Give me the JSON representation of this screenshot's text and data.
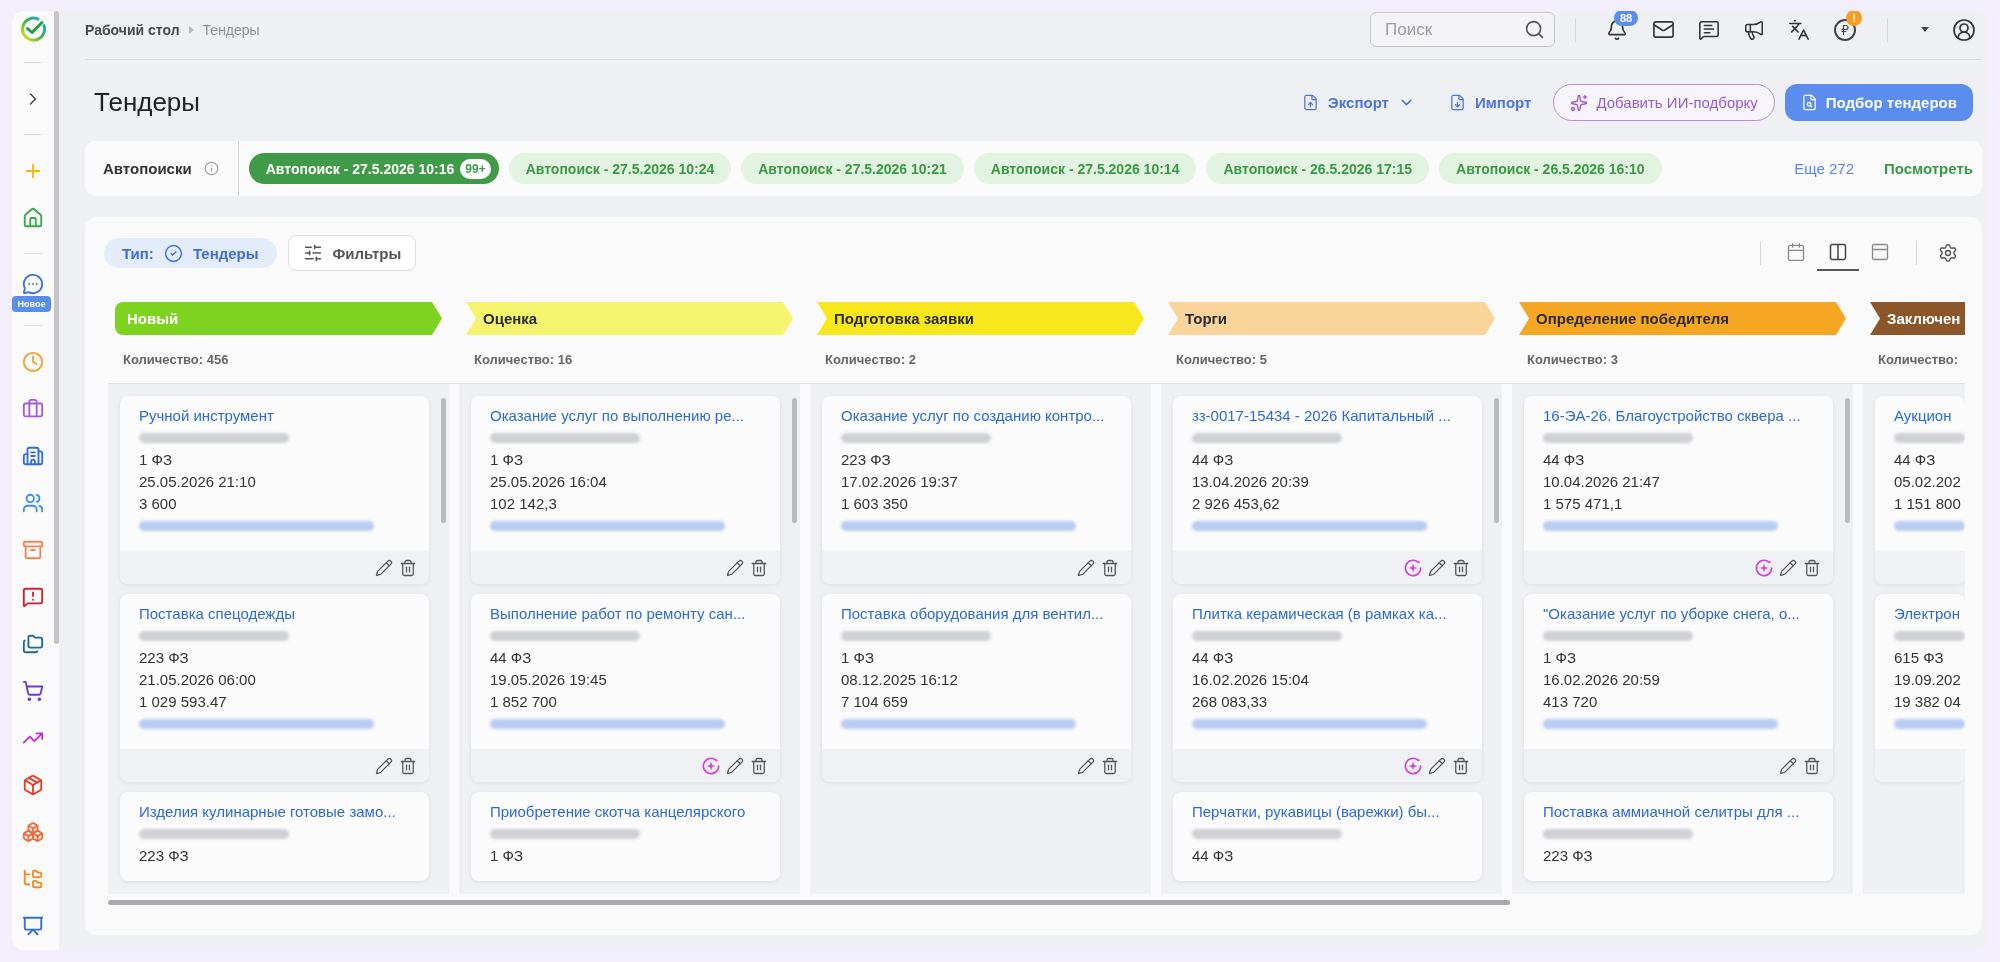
{
  "sidebar": {
    "new_badge": "Новое"
  },
  "topbar": {
    "breadcrumbs": [
      {
        "label": "Рабочий стол",
        "current": false
      },
      {
        "label": "Тендеры",
        "current": true
      }
    ],
    "search": {
      "placeholder": "Поиск"
    },
    "notifications_badge": "88",
    "coin_badge": "!"
  },
  "page": {
    "title": "Тендеры",
    "actions": [
      {
        "kind": "export",
        "label": "Экспорт"
      },
      {
        "kind": "import",
        "label": "Импорт"
      },
      {
        "kind": "ai",
        "label": "Добавить ИИ-подборку"
      },
      {
        "kind": "primary",
        "label": "Подбор тендеров"
      }
    ]
  },
  "autosearch": {
    "label": "Автопоиски",
    "chips": [
      {
        "label": "Автопоиск - 27.5.2026 10:16",
        "count": "99+",
        "selected": true
      },
      {
        "label": "Автопоиск - 27.5.2026 10:24",
        "selected": false
      },
      {
        "label": "Автопоиск - 27.5.2026 10:21",
        "selected": false
      },
      {
        "label": "Автопоиск - 27.5.2026 10:14",
        "selected": false
      },
      {
        "label": "Автопоиск - 26.5.2026 17:15",
        "selected": false
      },
      {
        "label": "Автопоиск - 26.5.2026 16:10",
        "selected": false
      }
    ],
    "more": "Еще 272",
    "view_all": "Посмотреть"
  },
  "board": {
    "type_filter": {
      "label": "Тип:",
      "value": "Тендеры"
    },
    "filters": "Фильтры",
    "views": [
      {
        "kind": "calendar",
        "selected": false
      },
      {
        "kind": "columns",
        "selected": true
      },
      {
        "kind": "panel",
        "selected": false
      }
    ],
    "columns": [
      {
        "title": "Новый",
        "color": "#7ed321",
        "count": "Количество: 456",
        "cards": [
          {
            "title": "Ручной инструмент",
            "law": "1 ФЗ",
            "date": "25.05.2026 21:10",
            "price": "3 600",
            "actions": [
              {
                "kind": "edit"
              },
              {
                "kind": "delete"
              }
            ]
          },
          {
            "title": "Поставка спецодежды",
            "law": "223 ФЗ",
            "date": "21.05.2026 06:00",
            "price": "1 029 593.47",
            "actions": [
              {
                "kind": "edit"
              },
              {
                "kind": "delete"
              }
            ]
          },
          {
            "title": "Изделия кулинарные готовые замо...",
            "law": "223 ФЗ"
          }
        ]
      },
      {
        "title": "Оценка",
        "color": "#f6f46e",
        "count": "Количество: 16",
        "cards": [
          {
            "title": "Оказание услуг по выполнению ре...",
            "law": "1 ФЗ",
            "date": "25.05.2026 16:04",
            "price": "102 142,3",
            "actions": [
              {
                "kind": "edit"
              },
              {
                "kind": "delete"
              }
            ]
          },
          {
            "title": "Выполнение работ по ремонту сан...",
            "law": "44 ФЗ",
            "date": "19.05.2026 19:45",
            "price": "1 852 700",
            "actions": [
              {
                "kind": "ai"
              },
              {
                "kind": "edit"
              },
              {
                "kind": "delete"
              }
            ]
          },
          {
            "title": "Приобретение скотча канцелярского",
            "law": "1 ФЗ"
          }
        ]
      },
      {
        "title": "Подготовка заявки",
        "color": "#f8e71c",
        "count": "Количество: 2",
        "cards": [
          {
            "title": "Оказание услуг по созданию контро...",
            "law": "223 ФЗ",
            "date": "17.02.2026 19:37",
            "price": "1 603 350",
            "actions": [
              {
                "kind": "edit"
              },
              {
                "kind": "delete"
              }
            ]
          },
          {
            "title": "Поставка оборудования для вентил...",
            "law": "1 ФЗ",
            "date": "08.12.2025 16:12",
            "price": "7 104 659",
            "actions": [
              {
                "kind": "edit"
              },
              {
                "kind": "delete"
              }
            ]
          }
        ]
      },
      {
        "title": "Торги",
        "color": "#f9d59b",
        "count": "Количество: 5",
        "cards": [
          {
            "title": "зз-0017-15434 - 2026 Капитальный ...",
            "law": "44 ФЗ",
            "date": "13.04.2026 20:39",
            "price": "2 926 453,62",
            "actions": [
              {
                "kind": "ai"
              },
              {
                "kind": "edit"
              },
              {
                "kind": "delete"
              }
            ]
          },
          {
            "title": "Плитка керамическая (в рамках ка...",
            "law": "44 ФЗ",
            "date": "16.02.2026 15:04",
            "price": "268 083,33",
            "actions": [
              {
                "kind": "ai"
              },
              {
                "kind": "edit"
              },
              {
                "kind": "delete"
              }
            ]
          },
          {
            "title": "Перчатки, рукавицы (варежки) бы...",
            "law": "44 ФЗ"
          }
        ]
      },
      {
        "title": "Определение победителя",
        "color": "#f5a623",
        "count": "Количество: 3",
        "cards": [
          {
            "title": "16-ЭА-26. Благоустройство сквера ...",
            "law": "44 ФЗ",
            "date": "10.04.2026 21:47",
            "price": "1 575 471,1",
            "actions": [
              {
                "kind": "ai"
              },
              {
                "kind": "edit"
              },
              {
                "kind": "delete"
              }
            ]
          },
          {
            "title": "\"Оказание услуг по уборке снега, о...",
            "law": "1 ФЗ",
            "date": "16.02.2026 20:59",
            "price": "413 720",
            "actions": [
              {
                "kind": "edit"
              },
              {
                "kind": "delete"
              }
            ]
          },
          {
            "title": "Поставка аммиачной селитры для ...",
            "law": "223 ФЗ"
          }
        ]
      },
      {
        "title": "Заключен",
        "color": "#8b572a",
        "count": "Количество:",
        "cards": [
          {
            "title": "Аукцион",
            "law": "44 ФЗ",
            "date": "05.02.202",
            "price": "1 151 800"
          },
          {
            "title": "Электрон",
            "law": "615 ФЗ",
            "date": "19.09.202",
            "price": "19 382 04"
          }
        ]
      }
    ]
  }
}
